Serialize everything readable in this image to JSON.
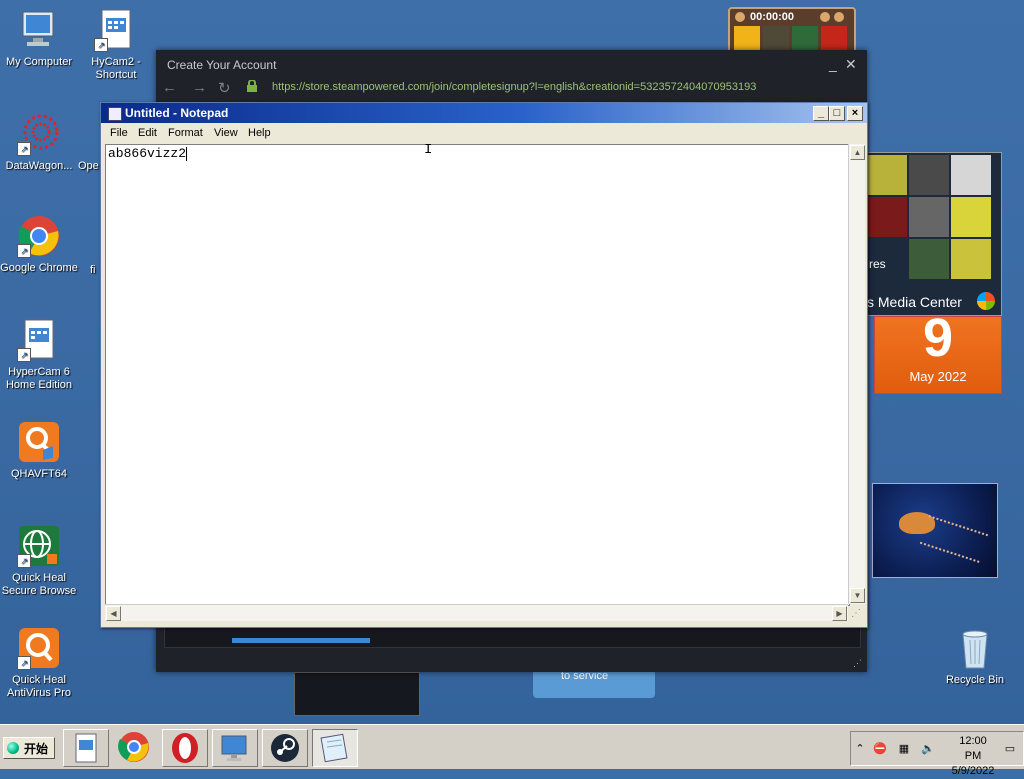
{
  "desktop_icons": [
    {
      "label": "My Computer"
    },
    {
      "label": "HyCam2 - Shortcut"
    },
    {
      "label": "DataWagon..."
    },
    {
      "label": "Ope"
    },
    {
      "label": "Google Chrome"
    },
    {
      "label": "fi"
    },
    {
      "label": "HyperCam 6 Home Edition"
    },
    {
      "label": "QHAVFT64"
    },
    {
      "label": "Quick Heal Secure Browse"
    },
    {
      "label": "Quick Heal AntiVirus Pro"
    },
    {
      "label": "Recycle Bin"
    }
  ],
  "steam": {
    "title": "Create Your Account",
    "url": "https://store.steampowered.com/join/completesignup?l=english&creationid=5323572404070953193",
    "minimize": "_",
    "close": "✕"
  },
  "notepad": {
    "title": "Untitled - Notepad",
    "menu": [
      "File",
      "Edit",
      "Format",
      "View",
      "Help"
    ],
    "content": "ab866vizz2"
  },
  "gadgets": {
    "clock": "00:00:00",
    "media_center_label": "s Media Center",
    "media_center_res": "res",
    "calendar_day": "9",
    "calendar_month": "May 2022",
    "behind_text": "to service"
  },
  "taskbar": {
    "start_label": "开始",
    "time": "12:00 PM",
    "date": "5/9/2022"
  },
  "colors": {
    "desktop": "#3a6ea5",
    "notepad_title": "#0a2a8a",
    "steam_bg": "#1f2229",
    "steam_url": "#9bc27a"
  }
}
